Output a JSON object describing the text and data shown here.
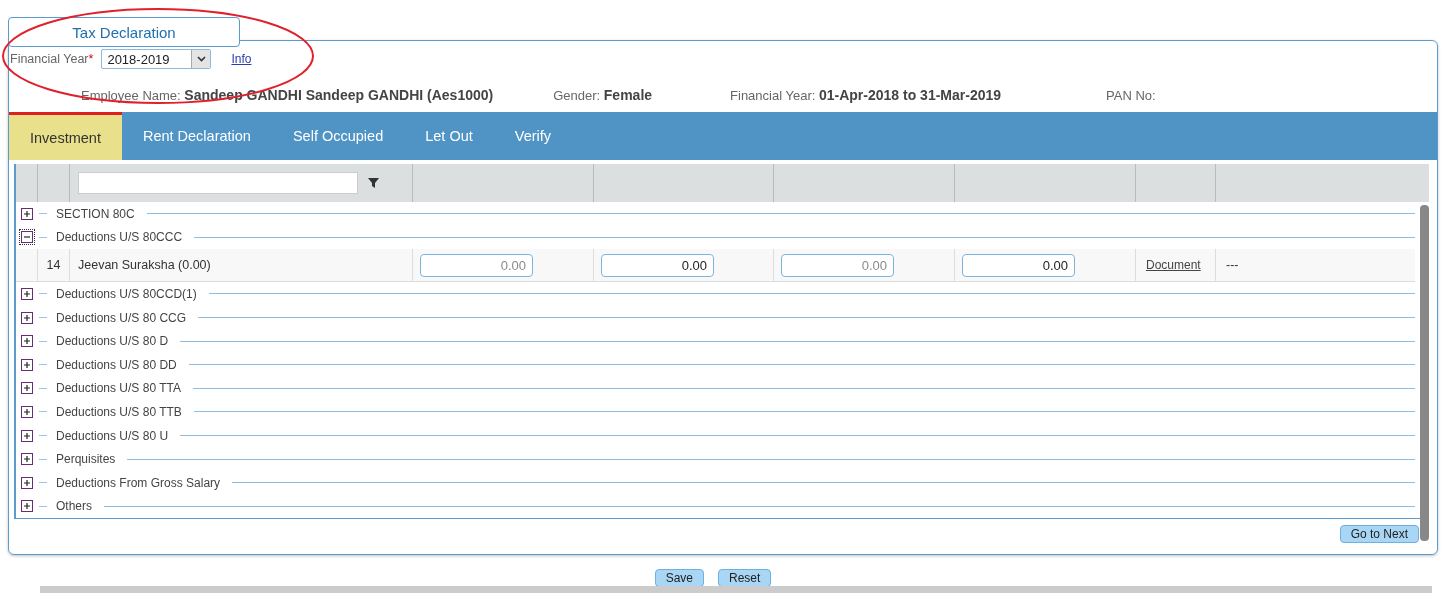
{
  "page_tab": {
    "label": "Tax Declaration"
  },
  "financial_year": {
    "label": "Financial Year",
    "required_mark": "*",
    "value": "2018-2019",
    "info_link": "Info"
  },
  "employee": [
    {
      "label": "Employee Name:",
      "value": "Sandeep GANDHI Sandeep GANDHI (Aes1000)"
    },
    {
      "label": "Gender:",
      "value": "Female"
    },
    {
      "label": "Financial Year:",
      "value": "01-Apr-2018 to 31-Mar-2019"
    },
    {
      "label": "PAN No:"
    }
  ],
  "tabs": [
    {
      "label": "Investment",
      "selected": true
    },
    {
      "label": "Rent Declaration",
      "selected": false
    },
    {
      "label": "Self Occupied",
      "selected": false
    },
    {
      "label": "Let Out",
      "selected": false
    },
    {
      "label": "Verify",
      "selected": false
    }
  ],
  "grid": {
    "groups": [
      {
        "label": "SECTION 80C",
        "expanded": false
      },
      {
        "label": "Deductions U/S 80CCC",
        "expanded": true,
        "rows": [
          {
            "number": "14",
            "name": "Jeevan Suraksha (0.00)",
            "amounts": [
              {
                "value": "0.00",
                "disabled": true
              },
              {
                "value": "0.00",
                "disabled": false
              },
              {
                "value": "0.00",
                "disabled": true
              },
              {
                "value": "0.00",
                "disabled": false
              }
            ],
            "document": "Document",
            "status": "---"
          }
        ]
      },
      {
        "label": "Deductions U/S 80CCD(1)",
        "expanded": false
      },
      {
        "label": "Deductions U/S 80 CCG",
        "expanded": false
      },
      {
        "label": "Deductions U/S 80 D",
        "expanded": false
      },
      {
        "label": "Deductions U/S 80 DD",
        "expanded": false
      },
      {
        "label": "Deductions U/S 80 TTA",
        "expanded": false
      },
      {
        "label": "Deductions U/S 80 TTB",
        "expanded": false
      },
      {
        "label": "Deductions U/S 80 U",
        "expanded": false
      },
      {
        "label": "Perquisites",
        "expanded": false
      },
      {
        "label": "Deductions From Gross Salary",
        "expanded": false
      },
      {
        "label": "Others",
        "expanded": false
      }
    ]
  },
  "next_button": "Go to Next",
  "buttons": [
    "Save",
    "Reset"
  ]
}
